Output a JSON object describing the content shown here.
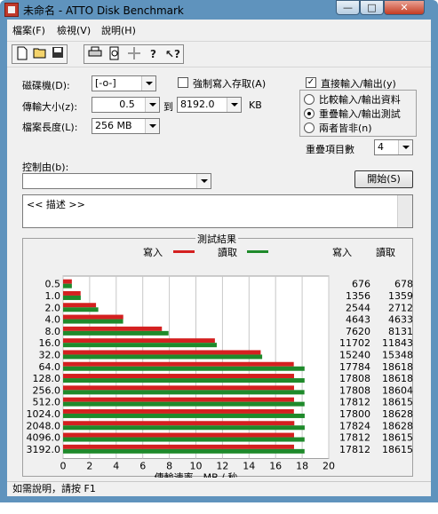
{
  "window": {
    "title": "未命名 - ATTO Disk Benchmark",
    "minimize": "—",
    "maximize": "□",
    "close": "✕"
  },
  "menu": [
    "檔案(F)",
    "檢視(V)",
    "說明(H)"
  ],
  "toolbar": {
    "icons": [
      "new-icon",
      "open-icon",
      "save-icon",
      "print-icon",
      "print-preview-icon",
      "move-icon",
      "about-icon",
      "help-pointer-icon"
    ]
  },
  "settings": {
    "drive_label": "磁碟機(D):",
    "drive_value": "[-o-]",
    "force_write_label": "強制寫入存取(A)",
    "force_write_checked": false,
    "direct_io_label": "直接輸入/輸出(y)",
    "direct_io_checked": true,
    "transfer_size_label": "傳輸大小(z):",
    "transfer_from": "0.5",
    "to_label": "到",
    "transfer_to": "8192.0",
    "kb_label": "KB",
    "file_length_label": "檔案長度(L):",
    "file_length_value": "256 MB",
    "io_modes": [
      {
        "label": "比較輸入/輸出資料",
        "selected": false
      },
      {
        "label": "重疊輸入/輸出測試",
        "selected": true
      },
      {
        "label": "兩者皆非(n)",
        "selected": false
      }
    ],
    "queue_depth_label": "重疊項目數",
    "queue_depth_value": "4",
    "controlled_by_label": "控制由(b):",
    "controlled_by_value": "",
    "start_button": "開始(S)",
    "description": "<<  描述  >>"
  },
  "results": {
    "title": "測試結果",
    "write_legend": "寫入",
    "read_legend": "讀取",
    "write_header": "寫入",
    "read_header": "讀取",
    "rows": [
      {
        "size": "0.5",
        "write": "676",
        "read": "678"
      },
      {
        "size": "1.0",
        "write": "1356",
        "read": "1359"
      },
      {
        "size": "2.0",
        "write": "2544",
        "read": "2712"
      },
      {
        "size": "4.0",
        "write": "4643",
        "read": "4633"
      },
      {
        "size": "8.0",
        "write": "7620",
        "read": "8131"
      },
      {
        "size": "16.0",
        "write": "11702",
        "read": "11843"
      },
      {
        "size": "32.0",
        "write": "15240",
        "read": "15348"
      },
      {
        "size": "64.0",
        "write": "17784",
        "read": "18618"
      },
      {
        "size": "128.0",
        "write": "17808",
        "read": "18618"
      },
      {
        "size": "256.0",
        "write": "17808",
        "read": "18604"
      },
      {
        "size": "512.0",
        "write": "17812",
        "read": "18615"
      },
      {
        "size": "1024.0",
        "write": "17800",
        "read": "18628"
      },
      {
        "size": "2048.0",
        "write": "17824",
        "read": "18628"
      },
      {
        "size": "4096.0",
        "write": "17812",
        "read": "18615"
      },
      {
        "size": "3192.0",
        "write": "17812",
        "read": "18615"
      }
    ]
  },
  "chart_data": {
    "type": "bar",
    "orientation": "horizontal",
    "title": "測試結果",
    "xlabel": "傳輸速率 - MB / 秒",
    "ylabel": "",
    "xlim": [
      0,
      20
    ],
    "x_ticks": [
      "0",
      "2",
      "4",
      "6",
      "8",
      "10",
      "12",
      "14",
      "16",
      "18",
      "20"
    ],
    "categories": [
      "0.5",
      "1.0",
      "2.0",
      "4.0",
      "8.0",
      "16.0",
      "32.0",
      "64.0",
      "128.0",
      "256.0",
      "512.0",
      "1024.0",
      "2048.0",
      "4096.0",
      "3192.0"
    ],
    "series": [
      {
        "name": "寫入",
        "color": "#d42020",
        "values": [
          0.66,
          1.32,
          2.48,
          4.53,
          7.44,
          11.43,
          14.88,
          17.37,
          17.39,
          17.39,
          17.39,
          17.38,
          17.41,
          17.39,
          17.39
        ]
      },
      {
        "name": "讀取",
        "color": "#1f8a2b",
        "values": [
          0.66,
          1.33,
          2.65,
          4.52,
          7.94,
          11.57,
          14.99,
          18.18,
          18.18,
          18.17,
          18.18,
          18.19,
          18.19,
          18.18,
          18.18
        ]
      }
    ],
    "grid": true,
    "legend": "top"
  },
  "status": {
    "text": "如需說明，請按 F1"
  },
  "colors": {
    "title_bar": "#5f93bd",
    "write_bar": "#d42020",
    "read_bar": "#1f8a2b"
  }
}
